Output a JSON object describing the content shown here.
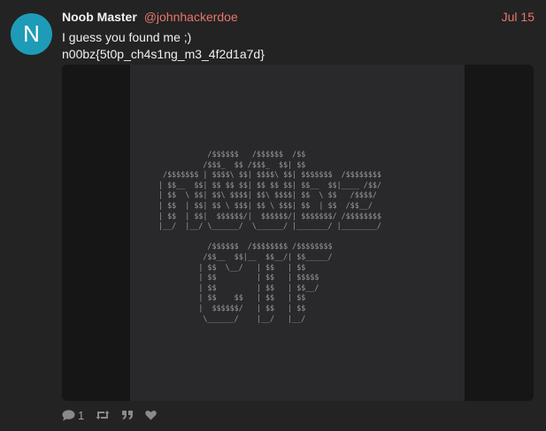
{
  "post": {
    "avatar_letter": "N",
    "avatar_color": "#1e9cb7",
    "display_name": "Noob Master",
    "handle": "@johnhackerdoe",
    "date": "Jul 15",
    "lines": [
      "I guess you found me ;)",
      "n00bz{5t0p_ch4s1ng_m3_4f2d1a7d}"
    ],
    "image_ascii": "           /$$$$$$   /$$$$$$  /$$\n          /$$$_  $$ /$$$_  $$| $$\n /$$$$$$$ | $$$$\\ $$| $$$$\\ $$| $$$$$$$  /$$$$$$$$\n| $$__  $$| $$ $$ $$| $$ $$ $$| $$__  $$|____ /$$/\n| $$  \\ $$| $$\\ $$$$| $$\\ $$$$| $$  \\ $$   /$$$$/\n| $$  | $$| $$ \\ $$$| $$ \\ $$$| $$  | $$  /$$__/\n| $$  | $$|  $$$$$$/|  $$$$$$/| $$$$$$$/ /$$$$$$$$\n|__/  |__/ \\______/  \\______/ |_______/ |________/\n\n           /$$$$$$  /$$$$$$$$ /$$$$$$$$\n          /$$__  $$|__  $$__/| $$_____/\n         | $$  \\__/   | $$   | $$\n         | $$         | $$   | $$$$$\n         | $$         | $$   | $$__/\n         | $$    $$   | $$   | $$\n         |  $$$$$$/   | $$   | $$\n          \\______/    |__/   |__/"
  },
  "actions": {
    "reply_icon": "speech-bubble-icon",
    "reply_count": "1",
    "boost_icon": "retweet-icon",
    "quote_icon": "quote-icon",
    "like_icon": "heart-icon"
  },
  "colors": {
    "background": "#232323",
    "accent": "#e8766a",
    "media_frame": "#161616",
    "media_panel": "#29292b"
  }
}
